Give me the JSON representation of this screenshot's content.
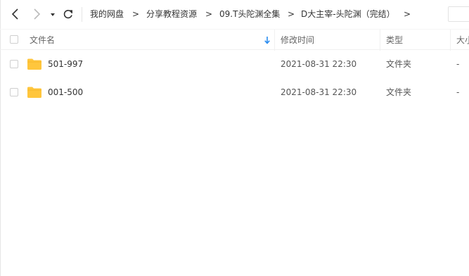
{
  "toolbar": {
    "back_icon": "chevron-left-icon",
    "forward_icon": "chevron-right-icon",
    "history_icon": "caret-down-icon",
    "refresh_icon": "refresh-icon",
    "breadcrumb": [
      "我的网盘",
      "分享教程资源",
      "09.T头陀渊全集",
      "D大主宰-头陀渊（完结）"
    ],
    "separator": ">"
  },
  "header": {
    "name": "文件名",
    "modified": "修改时间",
    "type": "类型",
    "size": "大小",
    "sort_icon": "arrow-down-icon"
  },
  "files": [
    {
      "name": "501-997",
      "modified": "2021-08-31 22:30",
      "type": "文件夹",
      "size": "-",
      "icon": "folder-icon"
    },
    {
      "name": "001-500",
      "modified": "2021-08-31 22:30",
      "type": "文件夹",
      "size": "-",
      "icon": "folder-icon"
    }
  ],
  "colors": {
    "folder": "#ffc63d",
    "sort_arrow": "#2a8cf0",
    "border": "#f0f0f0"
  }
}
